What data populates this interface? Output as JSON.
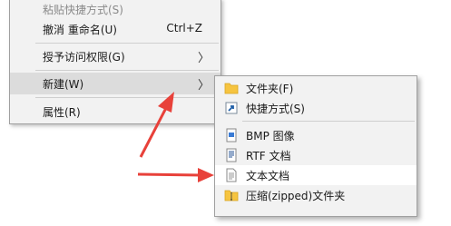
{
  "context_menu": {
    "items": [
      {
        "label": "粘贴快捷方式(S)",
        "shortcut": "",
        "disabled": true
      },
      {
        "label": "撤消 重命名(U)",
        "shortcut": "Ctrl+Z"
      },
      {
        "label": "授予访问权限(G)",
        "has_submenu": true
      },
      {
        "label": "新建(W)",
        "has_submenu": true,
        "highlighted": true
      },
      {
        "label": "属性(R)"
      }
    ]
  },
  "new_submenu": {
    "items": [
      {
        "label": "文件夹(F)",
        "icon": "folder-icon"
      },
      {
        "label": "快捷方式(S)",
        "icon": "shortcut-icon"
      },
      {
        "label": "BMP 图像",
        "icon": "bmp-image-icon"
      },
      {
        "label": "RTF 文档",
        "icon": "rtf-document-icon"
      },
      {
        "label": "文本文档",
        "icon": "text-document-icon",
        "highlighted": true
      },
      {
        "label": "压缩(zipped)文件夹",
        "icon": "zip-folder-icon"
      }
    ]
  },
  "colors": {
    "annotation_arrow": "#e8413a",
    "menu_bg": "#f2f2f2"
  }
}
